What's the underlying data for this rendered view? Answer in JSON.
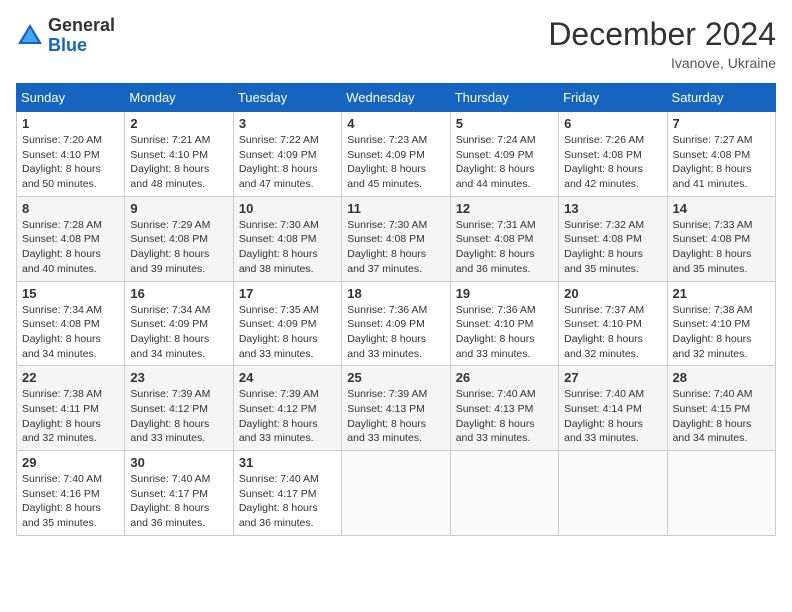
{
  "header": {
    "logo_line1": "General",
    "logo_line2": "Blue",
    "month": "December 2024",
    "location": "Ivanove, Ukraine"
  },
  "weekdays": [
    "Sunday",
    "Monday",
    "Tuesday",
    "Wednesday",
    "Thursday",
    "Friday",
    "Saturday"
  ],
  "weeks": [
    [
      {
        "day": "1",
        "sunrise": "Sunrise: 7:20 AM",
        "sunset": "Sunset: 4:10 PM",
        "daylight": "Daylight: 8 hours and 50 minutes."
      },
      {
        "day": "2",
        "sunrise": "Sunrise: 7:21 AM",
        "sunset": "Sunset: 4:10 PM",
        "daylight": "Daylight: 8 hours and 48 minutes."
      },
      {
        "day": "3",
        "sunrise": "Sunrise: 7:22 AM",
        "sunset": "Sunset: 4:09 PM",
        "daylight": "Daylight: 8 hours and 47 minutes."
      },
      {
        "day": "4",
        "sunrise": "Sunrise: 7:23 AM",
        "sunset": "Sunset: 4:09 PM",
        "daylight": "Daylight: 8 hours and 45 minutes."
      },
      {
        "day": "5",
        "sunrise": "Sunrise: 7:24 AM",
        "sunset": "Sunset: 4:09 PM",
        "daylight": "Daylight: 8 hours and 44 minutes."
      },
      {
        "day": "6",
        "sunrise": "Sunrise: 7:26 AM",
        "sunset": "Sunset: 4:08 PM",
        "daylight": "Daylight: 8 hours and 42 minutes."
      },
      {
        "day": "7",
        "sunrise": "Sunrise: 7:27 AM",
        "sunset": "Sunset: 4:08 PM",
        "daylight": "Daylight: 8 hours and 41 minutes."
      }
    ],
    [
      {
        "day": "8",
        "sunrise": "Sunrise: 7:28 AM",
        "sunset": "Sunset: 4:08 PM",
        "daylight": "Daylight: 8 hours and 40 minutes."
      },
      {
        "day": "9",
        "sunrise": "Sunrise: 7:29 AM",
        "sunset": "Sunset: 4:08 PM",
        "daylight": "Daylight: 8 hours and 39 minutes."
      },
      {
        "day": "10",
        "sunrise": "Sunrise: 7:30 AM",
        "sunset": "Sunset: 4:08 PM",
        "daylight": "Daylight: 8 hours and 38 minutes."
      },
      {
        "day": "11",
        "sunrise": "Sunrise: 7:30 AM",
        "sunset": "Sunset: 4:08 PM",
        "daylight": "Daylight: 8 hours and 37 minutes."
      },
      {
        "day": "12",
        "sunrise": "Sunrise: 7:31 AM",
        "sunset": "Sunset: 4:08 PM",
        "daylight": "Daylight: 8 hours and 36 minutes."
      },
      {
        "day": "13",
        "sunrise": "Sunrise: 7:32 AM",
        "sunset": "Sunset: 4:08 PM",
        "daylight": "Daylight: 8 hours and 35 minutes."
      },
      {
        "day": "14",
        "sunrise": "Sunrise: 7:33 AM",
        "sunset": "Sunset: 4:08 PM",
        "daylight": "Daylight: 8 hours and 35 minutes."
      }
    ],
    [
      {
        "day": "15",
        "sunrise": "Sunrise: 7:34 AM",
        "sunset": "Sunset: 4:08 PM",
        "daylight": "Daylight: 8 hours and 34 minutes."
      },
      {
        "day": "16",
        "sunrise": "Sunrise: 7:34 AM",
        "sunset": "Sunset: 4:09 PM",
        "daylight": "Daylight: 8 hours and 34 minutes."
      },
      {
        "day": "17",
        "sunrise": "Sunrise: 7:35 AM",
        "sunset": "Sunset: 4:09 PM",
        "daylight": "Daylight: 8 hours and 33 minutes."
      },
      {
        "day": "18",
        "sunrise": "Sunrise: 7:36 AM",
        "sunset": "Sunset: 4:09 PM",
        "daylight": "Daylight: 8 hours and 33 minutes."
      },
      {
        "day": "19",
        "sunrise": "Sunrise: 7:36 AM",
        "sunset": "Sunset: 4:10 PM",
        "daylight": "Daylight: 8 hours and 33 minutes."
      },
      {
        "day": "20",
        "sunrise": "Sunrise: 7:37 AM",
        "sunset": "Sunset: 4:10 PM",
        "daylight": "Daylight: 8 hours and 32 minutes."
      },
      {
        "day": "21",
        "sunrise": "Sunrise: 7:38 AM",
        "sunset": "Sunset: 4:10 PM",
        "daylight": "Daylight: 8 hours and 32 minutes."
      }
    ],
    [
      {
        "day": "22",
        "sunrise": "Sunrise: 7:38 AM",
        "sunset": "Sunset: 4:11 PM",
        "daylight": "Daylight: 8 hours and 32 minutes."
      },
      {
        "day": "23",
        "sunrise": "Sunrise: 7:39 AM",
        "sunset": "Sunset: 4:12 PM",
        "daylight": "Daylight: 8 hours and 33 minutes."
      },
      {
        "day": "24",
        "sunrise": "Sunrise: 7:39 AM",
        "sunset": "Sunset: 4:12 PM",
        "daylight": "Daylight: 8 hours and 33 minutes."
      },
      {
        "day": "25",
        "sunrise": "Sunrise: 7:39 AM",
        "sunset": "Sunset: 4:13 PM",
        "daylight": "Daylight: 8 hours and 33 minutes."
      },
      {
        "day": "26",
        "sunrise": "Sunrise: 7:40 AM",
        "sunset": "Sunset: 4:13 PM",
        "daylight": "Daylight: 8 hours and 33 minutes."
      },
      {
        "day": "27",
        "sunrise": "Sunrise: 7:40 AM",
        "sunset": "Sunset: 4:14 PM",
        "daylight": "Daylight: 8 hours and 33 minutes."
      },
      {
        "day": "28",
        "sunrise": "Sunrise: 7:40 AM",
        "sunset": "Sunset: 4:15 PM",
        "daylight": "Daylight: 8 hours and 34 minutes."
      }
    ],
    [
      {
        "day": "29",
        "sunrise": "Sunrise: 7:40 AM",
        "sunset": "Sunset: 4:16 PM",
        "daylight": "Daylight: 8 hours and 35 minutes."
      },
      {
        "day": "30",
        "sunrise": "Sunrise: 7:40 AM",
        "sunset": "Sunset: 4:17 PM",
        "daylight": "Daylight: 8 hours and 36 minutes."
      },
      {
        "day": "31",
        "sunrise": "Sunrise: 7:40 AM",
        "sunset": "Sunset: 4:17 PM",
        "daylight": "Daylight: 8 hours and 36 minutes."
      },
      null,
      null,
      null,
      null
    ]
  ]
}
